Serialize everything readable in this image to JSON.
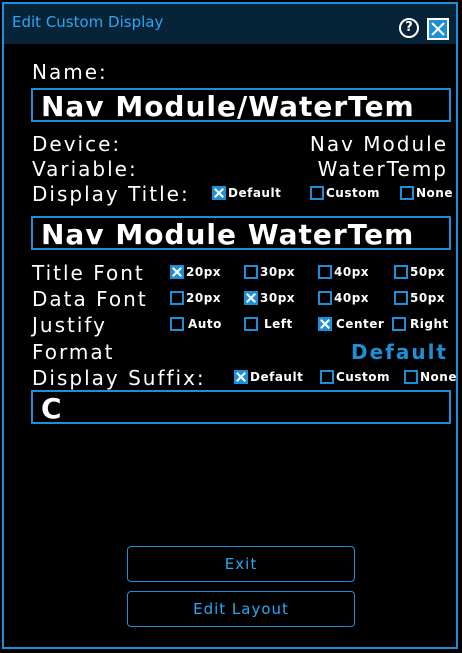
{
  "window": {
    "title": "Edit Custom Display",
    "help_glyph": "?",
    "accent": "#1d8fd8",
    "background": "#000000"
  },
  "name": {
    "label": "Name:",
    "value": "Nav Module/WaterTem"
  },
  "device": {
    "label": "Device:",
    "value": "Nav Module"
  },
  "variable": {
    "label": "Variable:",
    "value": "WaterTemp"
  },
  "display_title": {
    "label": "Display Title:",
    "options": [
      {
        "label": "Default",
        "checked": true
      },
      {
        "label": "Custom",
        "checked": false
      },
      {
        "label": "None",
        "checked": false
      }
    ],
    "value": "Nav Module WaterTem"
  },
  "title_font": {
    "label": "Title Font",
    "options": [
      {
        "label": "20px",
        "checked": true
      },
      {
        "label": "30px",
        "checked": false
      },
      {
        "label": "40px",
        "checked": false
      },
      {
        "label": "50px",
        "checked": false
      }
    ]
  },
  "data_font": {
    "label": "Data Font",
    "options": [
      {
        "label": "20px",
        "checked": false
      },
      {
        "label": "30px",
        "checked": true
      },
      {
        "label": "40px",
        "checked": false
      },
      {
        "label": "50px",
        "checked": false
      }
    ]
  },
  "justify": {
    "label": "Justify",
    "options": [
      {
        "label": "Auto",
        "checked": false
      },
      {
        "label": "Left",
        "checked": false
      },
      {
        "label": "Center",
        "checked": true
      },
      {
        "label": "Right",
        "checked": false
      }
    ]
  },
  "format": {
    "label": "Format",
    "value": "Default"
  },
  "display_suffix": {
    "label": "Display Suffix:",
    "options": [
      {
        "label": "Default",
        "checked": true
      },
      {
        "label": "Custom",
        "checked": false
      },
      {
        "label": "None",
        "checked": false
      }
    ],
    "value": "C"
  },
  "buttons": {
    "exit": "Exit",
    "edit_layout": "Edit Layout"
  }
}
